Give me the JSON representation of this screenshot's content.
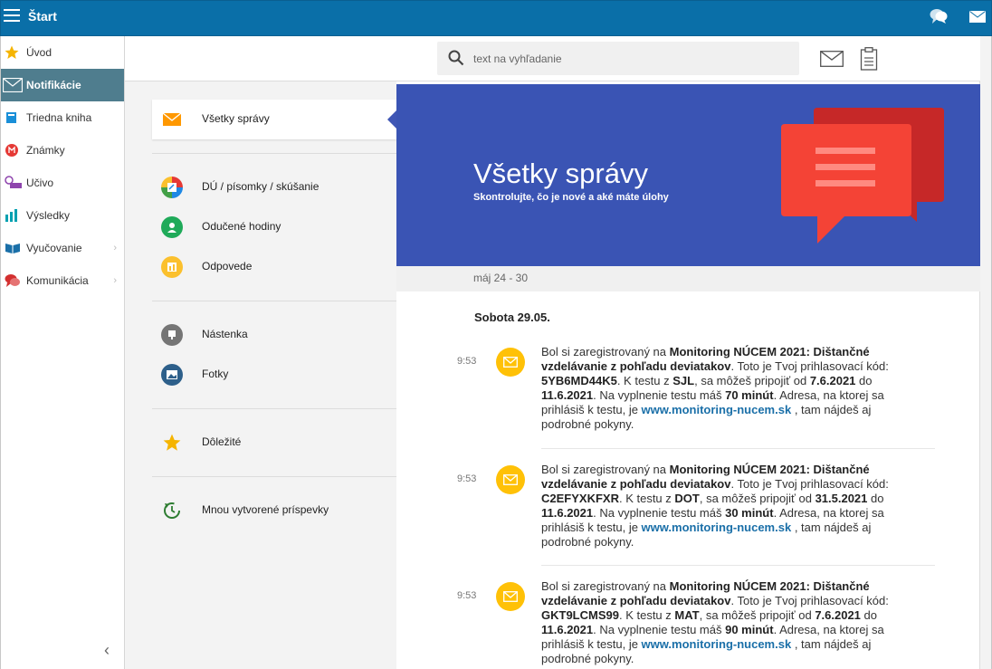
{
  "app": {
    "title": "Štart"
  },
  "sidebar": {
    "items": [
      {
        "label": "Úvod",
        "icon": "star-icon"
      },
      {
        "label": "Notifikácie",
        "icon": "envelope-icon",
        "active": true
      },
      {
        "label": "Triedna kniha",
        "icon": "book-icon"
      },
      {
        "label": "Známky",
        "icon": "grades-icon"
      },
      {
        "label": "Učivo",
        "icon": "monitor-icon"
      },
      {
        "label": "Výsledky",
        "icon": "bar-chart-icon"
      },
      {
        "label": "Vyučovanie",
        "icon": "open-book-icon",
        "has_children": true
      },
      {
        "label": "Komunikácia",
        "icon": "chat-bubbles-icon",
        "has_children": true
      }
    ],
    "collapse_glyph": "‹"
  },
  "search": {
    "placeholder": "text na vyhľadanie"
  },
  "filters": {
    "active": {
      "label": "Všetky správy",
      "icon": "envelope-icon"
    },
    "group1": [
      {
        "label": "DÚ / písomky / skúšanie",
        "icon": "homework-icon"
      },
      {
        "label": "Odučené hodiny",
        "icon": "person-icon"
      },
      {
        "label": "Odpovede",
        "icon": "answers-icon"
      }
    ],
    "group2": [
      {
        "label": "Nástenka",
        "icon": "noticeboard-icon"
      },
      {
        "label": "Fotky",
        "icon": "photo-icon"
      }
    ],
    "group3": [
      {
        "label": "Dôležité",
        "icon": "star-icon"
      }
    ],
    "group4": [
      {
        "label": "Mnou vytvorené príspevky",
        "icon": "history-icon"
      }
    ]
  },
  "hero": {
    "title": "Všetky správy",
    "subtitle": "Skontrolujte, čo je nové a aké máte úlohy"
  },
  "week": {
    "label": "máj 24 - 30"
  },
  "day": {
    "heading": "Sobota 29.05."
  },
  "messages": [
    {
      "time": "9:53",
      "t1": "Bol si zaregistrovaný na ",
      "b1": "Monitoring NÚCEM 2021: Dištančné vzdelávanie z pohľadu deviatakov",
      "t2": ". Toto je Tvoj prihlasovací kód: ",
      "code": "5YB6MD44K5",
      "t3": ". K testu z ",
      "subject": "SJL",
      "t4": ", sa môžeš pripojiť od ",
      "from": "7.6.2021",
      "t5": " do ",
      "to": "11.6.2021",
      "t6": ". Na vyplnenie testu máš ",
      "minutes": "70 minút",
      "t7": ". Adresa, na ktorej sa prihlásiš k testu, je ",
      "link": "www.monitoring-nucem.sk",
      "t8": " , tam nájdeš aj podrobné pokyny."
    },
    {
      "time": "9:53",
      "t1": "Bol si zaregistrovaný na ",
      "b1": "Monitoring NÚCEM 2021: Dištančné vzdelávanie z pohľadu deviatakov",
      "t2": ". Toto je Tvoj prihlasovací kód: ",
      "code": "C2EFYXKFXR",
      "t3": ". K testu z ",
      "subject": "DOT",
      "t4": ", sa môžeš pripojiť od ",
      "from": "31.5.2021",
      "t5": " do ",
      "to": "11.6.2021",
      "t6": ". Na vyplnenie testu máš ",
      "minutes": "30 minút",
      "t7": ". Adresa, na ktorej sa prihlásiš k testu, je ",
      "link": "www.monitoring-nucem.sk",
      "t8": " , tam nájdeš aj podrobné pokyny."
    },
    {
      "time": "9:53",
      "t1": "Bol si zaregistrovaný na ",
      "b1": "Monitoring NÚCEM 2021: Dištančné vzdelávanie z pohľadu deviatakov",
      "t2": ". Toto je Tvoj prihlasovací kód: ",
      "code": "GKT9LCMS99",
      "t3": ". K testu z ",
      "subject": "MAT",
      "t4": ", sa môžeš pripojiť od ",
      "from": "7.6.2021",
      "t5": " do ",
      "to": "11.6.2021",
      "t6": ". Na vyplnenie testu máš ",
      "minutes": "90 minút",
      "t7": ". Adresa, na ktorej sa prihlásiš k testu, je ",
      "link": "www.monitoring-nucem.sk",
      "t8": " , tam nájdeš aj podrobné pokyny."
    }
  ],
  "colors": {
    "topbar": "#0a6fa8",
    "sidebar_active": "#4f7d8e",
    "hero": "#3a54b4",
    "message_icon": "#ffc107",
    "link": "#1a6fa8"
  }
}
